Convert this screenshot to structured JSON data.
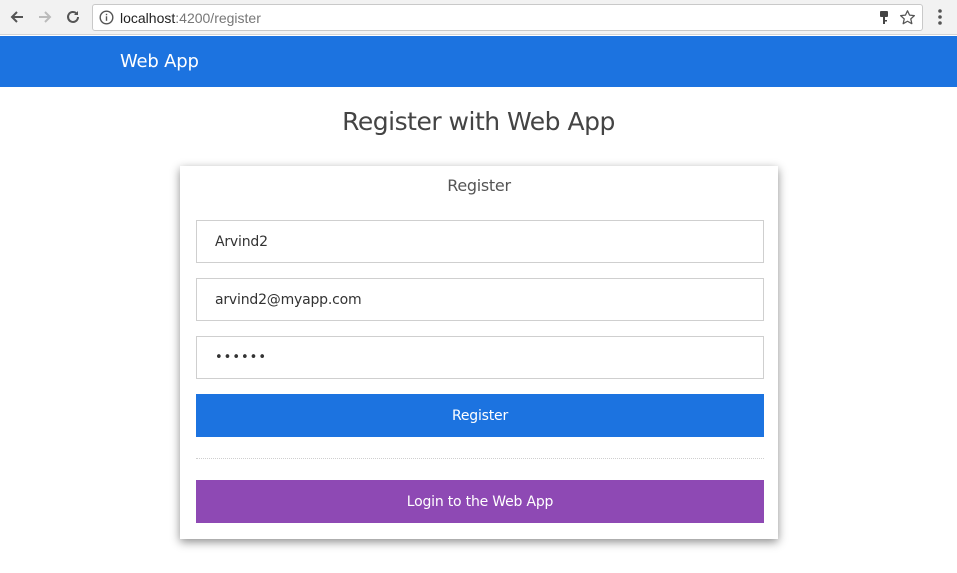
{
  "browser": {
    "url_host": "localhost",
    "url_path": ":4200/register",
    "icons": [
      "back-icon",
      "forward-icon",
      "reload-icon",
      "info-icon",
      "key-icon",
      "star-icon",
      "menu-icon"
    ]
  },
  "app": {
    "brand": "Web App",
    "brand_color": "#1c73e0"
  },
  "page": {
    "title": "Register with Web App"
  },
  "form": {
    "title": "Register",
    "name_value": "Arvind2",
    "email_value": "arvind2@myapp.com",
    "password_value": "••••••",
    "register_label": "Register",
    "register_color": "#1c73e0",
    "login_label": "Login to the Web App",
    "login_color": "#8e49b4"
  }
}
